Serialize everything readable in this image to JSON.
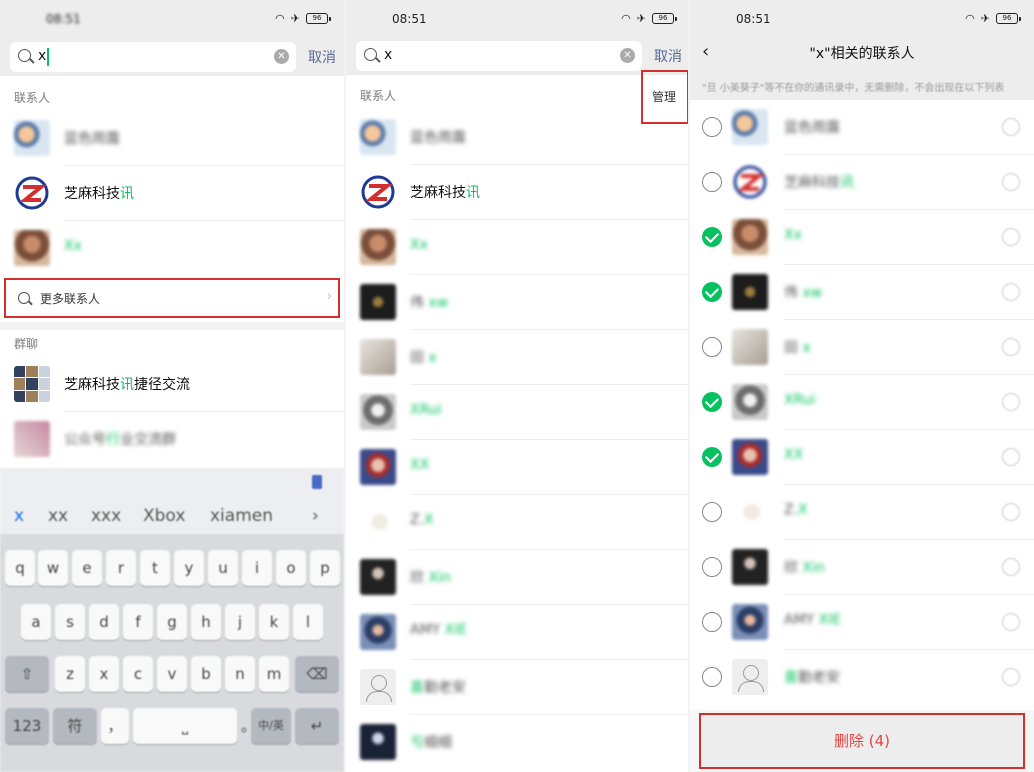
{
  "status": {
    "time_left": "08:51",
    "time_mid": "08:51",
    "time_right": "08:51",
    "battery": "96"
  },
  "icons": {
    "wifi": "wifi-icon",
    "airplane": "airplane-icon",
    "battery": "battery-icon",
    "search": "search-icon",
    "clear": "clear-icon",
    "back": "back-icon",
    "check": "check-icon"
  },
  "search": {
    "query": "x",
    "cancel": "取消"
  },
  "panel1": {
    "section_contacts": "联系人",
    "contacts": [
      {
        "name_pre": "蓝色雨露",
        "name_hl": "",
        "name_post": "",
        "blur": true
      },
      {
        "name_pre": "芝麻科技",
        "name_hl": "讯",
        "name_post": "",
        "blur": false
      },
      {
        "name_pre": "",
        "name_hl": "Xx",
        "name_post": "",
        "blur": true
      }
    ],
    "more_contacts": "更多联系人",
    "section_groups": "群聊",
    "groups": [
      {
        "name_pre": "芝麻科技",
        "name_hl": "讯",
        "name_post": "捷径交流",
        "blur": false
      },
      {
        "name_pre": "公众号",
        "name_hl": "行",
        "name_post": "业交流群",
        "blur": true
      }
    ]
  },
  "keyboard": {
    "suggestions": [
      "x",
      "xx",
      "xxx",
      "Xbox",
      "xiamen"
    ],
    "row1": [
      "q",
      "w",
      "e",
      "r",
      "t",
      "y",
      "u",
      "i",
      "o",
      "p"
    ],
    "row2": [
      "a",
      "s",
      "d",
      "f",
      "g",
      "h",
      "j",
      "k",
      "l"
    ],
    "row3": [
      "z",
      "x",
      "c",
      "v",
      "b",
      "n",
      "m"
    ],
    "key_123": "123",
    "key_symbols": "符",
    "key_comma": "，",
    "key_period": "。",
    "key_lang": "中/英"
  },
  "panel2": {
    "section_contacts": "联系人",
    "manage": "管理",
    "contacts": [
      {
        "name_pre": "蓝色雨露",
        "name_hl": "",
        "blur": true
      },
      {
        "name_pre": "芝麻科技",
        "name_hl": "讯",
        "blur": false
      },
      {
        "name_pre": "",
        "name_hl": "Xx",
        "blur": true
      },
      {
        "name_pre": "伟 ",
        "name_hl": "xw",
        "blur": true
      },
      {
        "name_pre": "田 ",
        "name_hl": "x",
        "blur": true
      },
      {
        "name_pre": "",
        "name_hl": "XRui",
        "blur": true
      },
      {
        "name_pre": "",
        "name_hl": "XX",
        "blur": true
      },
      {
        "name_pre": "Z.",
        "name_hl": "X",
        "blur": true
      },
      {
        "name_pre": "欣 ",
        "name_hl": "Xin",
        "blur": true
      },
      {
        "name_pre": "AMY ",
        "name_hl": "XIE",
        "blur": true
      },
      {
        "name_pre": "",
        "name_hl": "喜",
        "name_post": "勤老安",
        "blur": true
      },
      {
        "name_pre": "",
        "name_hl": "亏",
        "name_post": "细细",
        "blur": true
      }
    ]
  },
  "panel3": {
    "title": "\"x\"相关的联系人",
    "notice": "\"旦 小美葵子\"等不在你的通讯录中，无需删除，不会出现在以下列表",
    "rows": [
      {
        "name_pre": "蓝色雨露",
        "name_hl": "",
        "checked": false
      },
      {
        "name_pre": "芝麻科技",
        "name_hl": "讯",
        "checked": false
      },
      {
        "name_pre": "",
        "name_hl": "Xx",
        "checked": true
      },
      {
        "name_pre": "伟 ",
        "name_hl": "xw",
        "checked": true
      },
      {
        "name_pre": "田 ",
        "name_hl": "x",
        "checked": false
      },
      {
        "name_pre": "",
        "name_hl": "XRui",
        "checked": true
      },
      {
        "name_pre": "",
        "name_hl": "XX",
        "checked": true
      },
      {
        "name_pre": "Z.",
        "name_hl": "X",
        "checked": false
      },
      {
        "name_pre": "欣 ",
        "name_hl": "Xin",
        "checked": false
      },
      {
        "name_pre": "AMY ",
        "name_hl": "XIE",
        "checked": false
      },
      {
        "name_pre": "",
        "name_hl": "喜",
        "name_post": "勤老安",
        "checked": false
      }
    ],
    "delete": "删除 (4)"
  },
  "colors": {
    "accent_green": "#07c160",
    "link_blue": "#576b95",
    "annotation_red": "#d32f2f",
    "delete_red": "#e64340"
  }
}
